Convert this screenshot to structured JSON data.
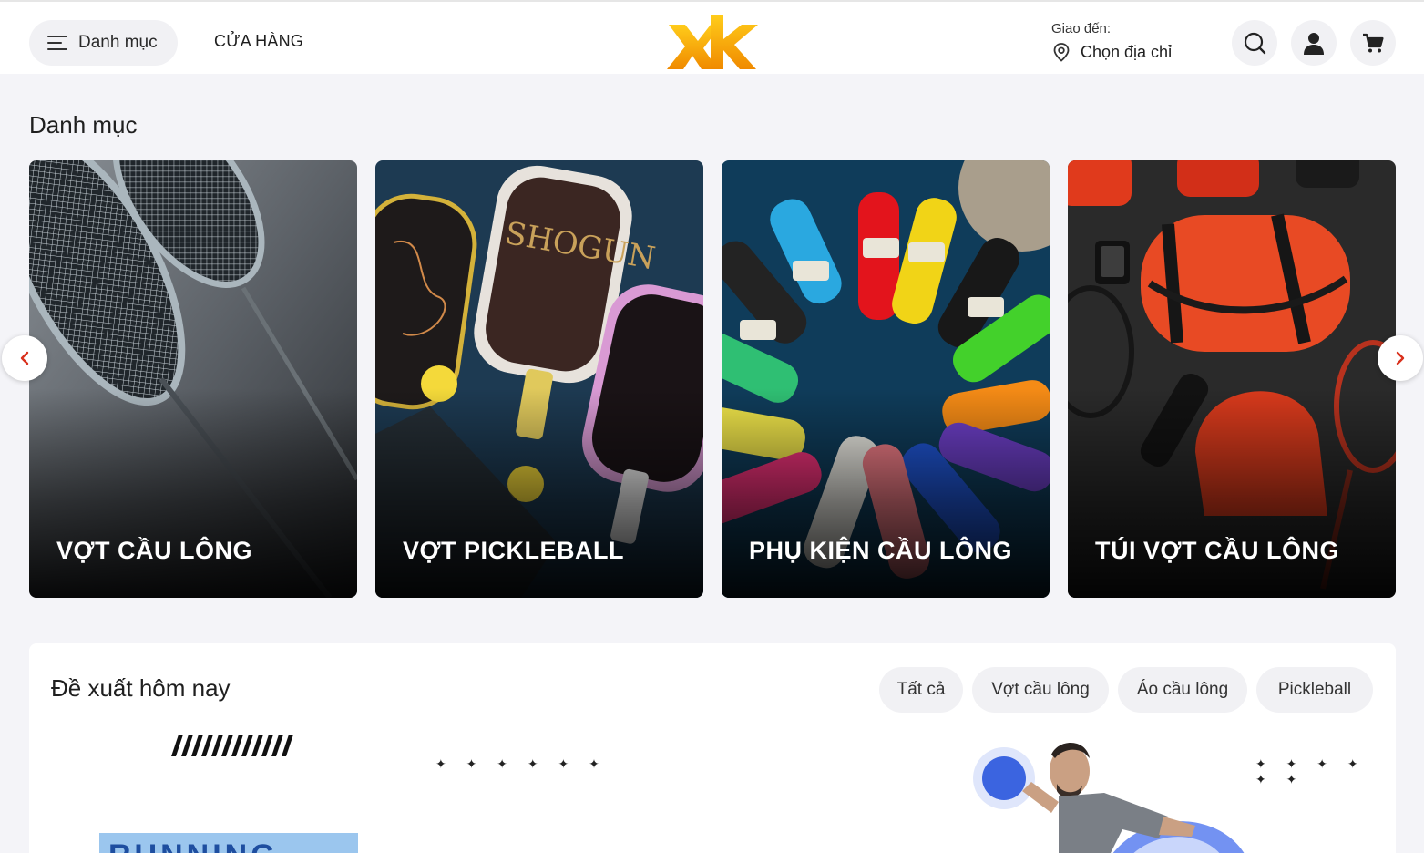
{
  "header": {
    "menu_label": "Danh mục",
    "store_label": "CỬA HÀNG",
    "logo_text": "XK",
    "deliver_caption": "Giao đến:",
    "deliver_address": "Chọn địa chỉ"
  },
  "categories": {
    "title": "Danh mục",
    "items": [
      {
        "label": "VỢT CẦU LÔNG"
      },
      {
        "label": "VỢT PICKLEBALL"
      },
      {
        "label": "PHỤ KIỆN CẦU LÔNG"
      },
      {
        "label": "TÚI VỢT CẦU LÔNG"
      }
    ],
    "paddle_brand": "SHOGUN"
  },
  "suggestions": {
    "title": "Đề xuất hôm nay",
    "chips": [
      "Tất cả",
      "Vợt cầu lông",
      "Áo cầu lông",
      "Pickleball"
    ],
    "banner_stars": "✦ ✦ ✦ ✦ ✦ ✦",
    "banner_word": "RUNNING"
  },
  "colors": {
    "accent_orange": "#f5a623",
    "arrow_red": "#d9301c",
    "page_bg": "#f4f4f8"
  }
}
